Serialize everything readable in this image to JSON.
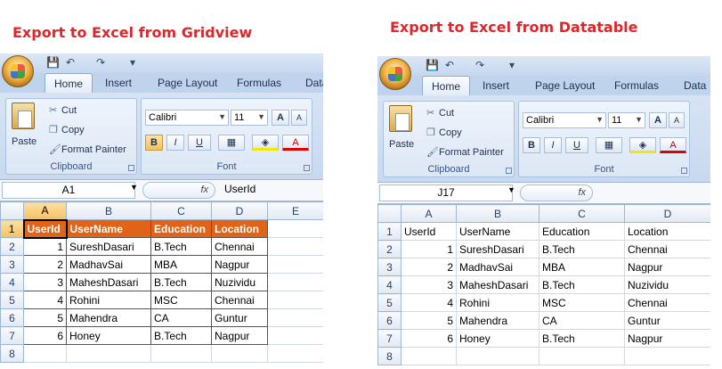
{
  "headings": {
    "left": "Export to Excel from Gridview",
    "right": "Export to Excel from Datatable"
  },
  "ribbon": {
    "tabs": [
      "Home",
      "Insert",
      "Page Layout",
      "Formulas",
      "Data"
    ],
    "right_tabs": [
      "Home",
      "Insert",
      "Page Layout",
      "Formulas",
      "Data"
    ],
    "clipboard": {
      "paste": "Paste",
      "cut": "Cut",
      "copy": "Copy",
      "format_painter": "Format Painter",
      "label": "Clipboard"
    },
    "font": {
      "name": "Calibri",
      "size": "11",
      "grow": "A",
      "shrink": "A",
      "bold": "B",
      "italic": "I",
      "underline": "U",
      "label": "Font",
      "fill_icon": "paint-bucket-icon",
      "font_color_icon": "font-color-icon"
    }
  },
  "left_sheet": {
    "name_box": "A1",
    "fx": "fx",
    "formula": "UserId",
    "columns": [
      "A",
      "B",
      "C",
      "D",
      "E"
    ],
    "row_numbers": [
      "1",
      "2",
      "3",
      "4",
      "5",
      "6",
      "7",
      "8"
    ],
    "header": [
      "UserId",
      "UserName",
      "Education",
      "Location"
    ],
    "rows": [
      [
        "1",
        "SureshDasari",
        "B.Tech",
        "Chennai"
      ],
      [
        "2",
        "MadhavSai",
        "MBA",
        "Nagpur"
      ],
      [
        "3",
        "MaheshDasari",
        "B.Tech",
        "Nuzividu"
      ],
      [
        "4",
        "Rohini",
        "MSC",
        "Chennai"
      ],
      [
        "5",
        "Mahendra",
        "CA",
        "Guntur"
      ],
      [
        "6",
        "Honey",
        "B.Tech",
        "Nagpur"
      ]
    ],
    "header_color": "#e06317"
  },
  "right_sheet": {
    "name_box": "J17",
    "fx": "fx",
    "formula": "",
    "columns": [
      "A",
      "B",
      "C",
      "D"
    ],
    "row_numbers": [
      "1",
      "2",
      "3",
      "4",
      "5",
      "6",
      "7",
      "8"
    ],
    "header": [
      "UserId",
      "UserName",
      "Education",
      "Location"
    ],
    "rows": [
      [
        "1",
        "SureshDasari",
        "B.Tech",
        "Chennai"
      ],
      [
        "2",
        "MadhavSai",
        "MBA",
        "Nagpur"
      ],
      [
        "3",
        "MaheshDasari",
        "B.Tech",
        "Nuzividu"
      ],
      [
        "4",
        "Rohini",
        "MSC",
        "Chennai"
      ],
      [
        "5",
        "Mahendra",
        "CA",
        "Guntur"
      ],
      [
        "6",
        "Honey",
        "B.Tech",
        "Nagpur"
      ]
    ]
  }
}
